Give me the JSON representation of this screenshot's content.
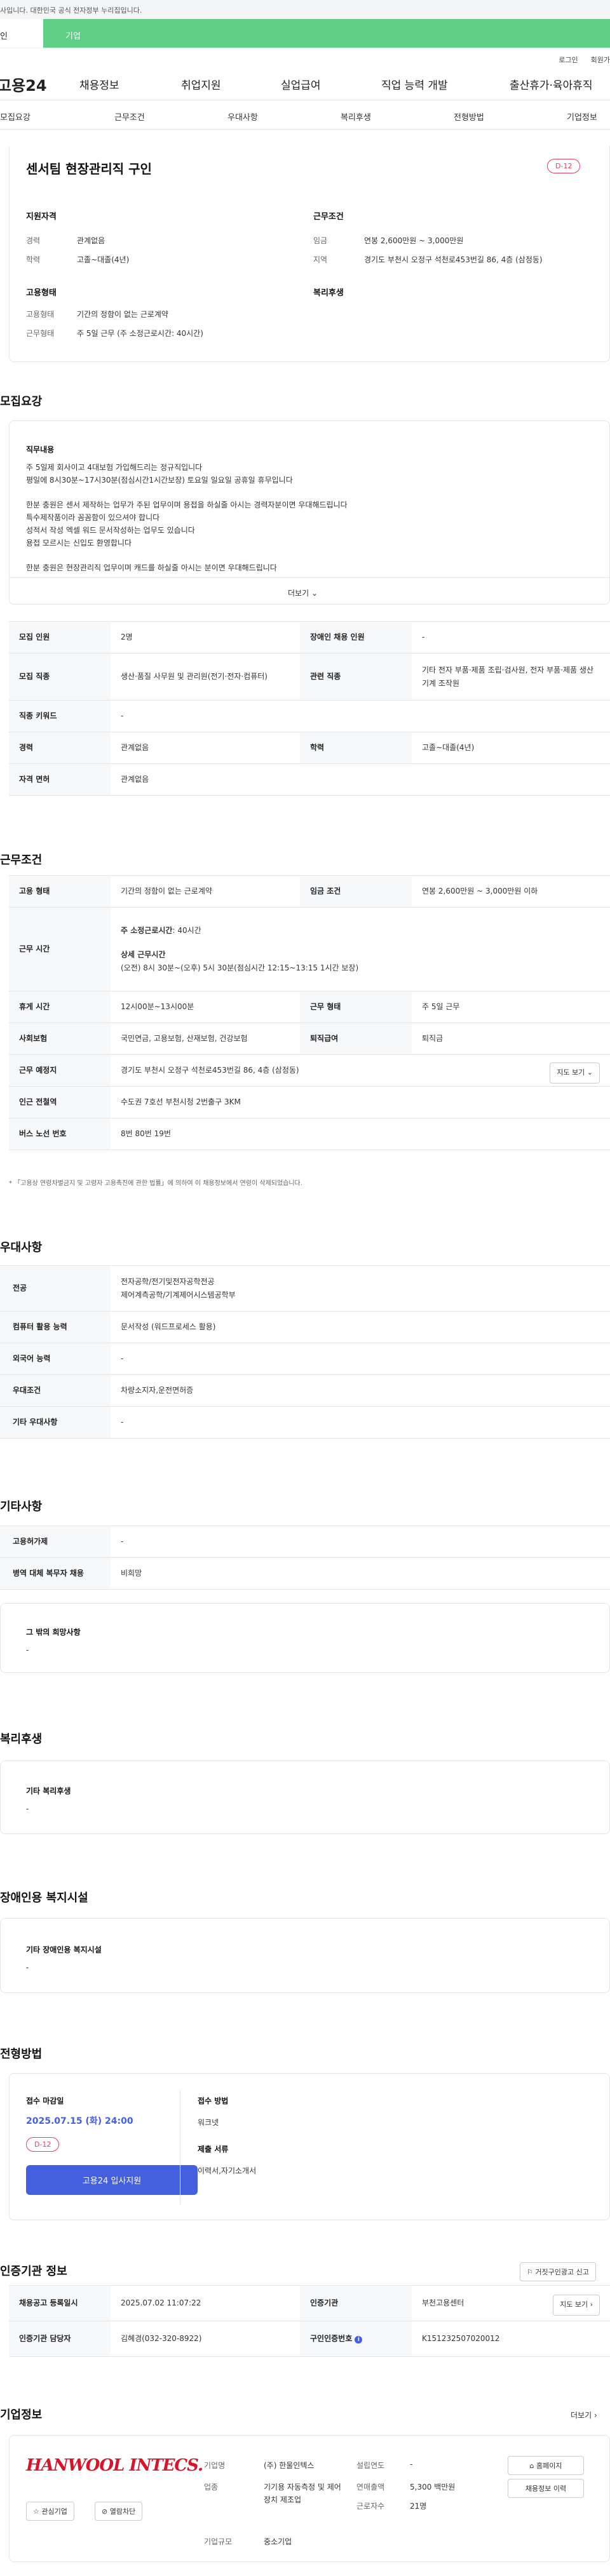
{
  "top_notice": "사입니다. 대한민국 공식 전자정부 누리집입니다.",
  "tabs": [
    "인",
    "기업"
  ],
  "util": [
    "로그인",
    "회원가"
  ],
  "gnb": {
    "logo": "고용24",
    "menu": [
      "채용정보",
      "취업지원",
      "실업급여",
      "직업 능력 개발",
      "출산휴가·육아휴직"
    ]
  },
  "subnav": [
    "모집요강",
    "근무조건",
    "우대사항",
    "복리후생",
    "전형방법",
    "기업정보"
  ],
  "job_title": "센서팀 현장관리직 구인",
  "dday": "D-12",
  "summary": {
    "qual_title": "지원자격",
    "career_lbl": "경력",
    "career_val": "관계없음",
    "edu_lbl": "학력",
    "edu_val": "고졸~대졸(4년)",
    "cond_title": "근무조건",
    "wage_lbl": "임금",
    "wage_val": "연봉 2,600만원 ~ 3,000만원",
    "region_lbl": "지역",
    "region_val": "경기도 부천시 오정구 석천로453번길 86, 4층 (삼정동)",
    "emp_title": "고용형태",
    "emptype_lbl": "고용형태",
    "emptype_val": "기간의 정함이 없는 근로계약",
    "worktype_lbl": "근무형태",
    "worktype_val": "주 5일 근무 (주 소정근로시간: 40시간)",
    "welfare_title": "복리후생"
  },
  "recruit": {
    "heading": "모집요강",
    "duty_title": "직무내용",
    "duty_text": "주 5일제 회사이고 4대보험 가입해드리는 정규직입니다\n평일에 8시30분~17시30분(점심시간1시간보장) 토요일 일요일 공휴일 휴무입니다\n\n한분 충원은 센서 제작하는 업무가 주된 업무이며 용접을 하실줄 아시는 경력자분이면 우대해드립니다\n특수제작품이라 꼼꼼함이 있으셔야 합니다\n성적서 작성 엑셀 워드 문서작성하는 업무도 있습니다\n용접 모르시는 신입도 환영합니다\n\n한분 충원은 현장관리직 업무이며 캐드를 하실줄 아시는 분이면 우대해드립니다",
    "more": "더보기",
    "rows": {
      "count_lbl": "모집 인원",
      "count_val": "2명",
      "disabled_lbl": "장애인 채용 인원",
      "disabled_val": "-",
      "job_lbl": "모집 직종",
      "job_val": "생산·품질 사무원 및 관리원(전기·전자·컴퓨터)",
      "rel_lbl": "관련 직종",
      "rel_val": "기타 전자 부품·제품 조립·검사원, 전자 부품·제품 생산기계 조작원",
      "kw_lbl": "직종 키워드",
      "kw_val": "-",
      "career_lbl": "경력",
      "career_val": "관계없음",
      "edu_lbl": "학력",
      "edu_val": "고졸~대졸(4년)",
      "license_lbl": "자격 면허",
      "license_val": "관계없음"
    }
  },
  "work": {
    "heading": "근무조건",
    "emp_lbl": "고용 형태",
    "emp_val": "기간의 정함이 없는 근로계약",
    "wage_lbl": "임금 조건",
    "wage_val": "연봉 2,600만원 ~ 3,000만원 이하",
    "time_lbl": "근무 시간",
    "time_weekly_lbl": "주 소정근로시간",
    "time_weekly_val": ": 40시간",
    "time_detail_lbl": "상세 근무시간",
    "time_detail_val": "(오전) 8시 30분~(오후) 5시 30분(점심시간 12:15~13:15 1시간 보장)",
    "break_lbl": "휴게 시간",
    "break_val": "12시00분~13시00분",
    "form_lbl": "근무 형태",
    "form_val": "주 5일 근무",
    "ins_lbl": "사회보험",
    "ins_val": "국민연금, 고용보험, 산재보험, 건강보험",
    "retire_lbl": "퇴직급여",
    "retire_val": "퇴직금",
    "place_lbl": "근무 예정지",
    "place_val": "경기도 부천시 오정구 석천로453번길 86, 4층 (삼정동)",
    "map_btn": "지도 보기",
    "subway_lbl": "인근 전철역",
    "subway_val": "수도권 7호선 부천시청 2번출구 3KM",
    "bus_lbl": "버스 노선 번호",
    "bus_val": "8번 80번 19번",
    "note": "「고용상 연령차별금지 및 고령자 고용촉진에 관한 법률」에 의하여 이 채용정보에서 연령이 삭제되었습니다."
  },
  "pref": {
    "heading": "우대사항",
    "major_lbl": "전공",
    "major_val": "전자공학/전기및전자공학전공\n제어계측공학/기계제어시스템공학부",
    "pc_lbl": "컴퓨터 활용 능력",
    "pc_val": "문서작성 (워드프로세스 활용)",
    "lang_lbl": "외국어 능력",
    "lang_val": "-",
    "cond_lbl": "우대조건",
    "cond_val": "차량소지자,운전면허증",
    "etc_lbl": "기타 우대사항",
    "etc_val": "-"
  },
  "etc": {
    "heading": "기타사항",
    "support_lbl": "고용허가제",
    "support_val": "-",
    "military_lbl": "병역 대체 복무자 채용",
    "military_val": "비희망",
    "other_title": "그 밖의 희망사항",
    "other_val": "-"
  },
  "welfare": {
    "heading": "복리후생",
    "title": "기타 복리후생",
    "val": "-"
  },
  "disabled_fac": {
    "heading": "장애인용 복지시설",
    "title": "기타 장애인용 복지시설",
    "val": "-"
  },
  "process": {
    "heading": "전형방법",
    "deadline_lbl": "접수 마감일",
    "deadline_val": "2025.07.15 (화) 24:00",
    "dday": "D-12",
    "apply_btn": "고용24 입사지원",
    "method_lbl": "접수 방법",
    "method_val": "워크넷",
    "docs_lbl": "제출 서류",
    "docs_val": "이력서,자기소개서"
  },
  "agency": {
    "heading": "인증기관 정보",
    "report_btn": "거짓구인광고 신고",
    "reg_lbl": "채용공고 등록일시",
    "reg_val": "2025.07.02 11:07:22",
    "org_lbl": "인증기관",
    "org_val": "부천고용센터",
    "map_btn": "지도 보기",
    "person_lbl": "인증기관 담당자",
    "person_val": "김혜경(032-320-8922)",
    "num_lbl": "구인인증번호",
    "num_val": "K151232507020012"
  },
  "company": {
    "heading": "기업정보",
    "more": "더보기",
    "logo": "HANWOOL INTECS.",
    "fav_btn": "관심기업",
    "block_btn": "열람차단",
    "name_lbl": "기업명",
    "name_val": "(주) 한울인텍스",
    "found_lbl": "설립연도",
    "found_val": "-",
    "biz_lbl": "업종",
    "biz_val": "기기용 자동측정 및 제어장치 제조업",
    "sales_lbl": "연매출액",
    "sales_val": "5,300 백만원",
    "emp_lbl": "근로자수",
    "emp_val": "21명",
    "size_lbl": "기업규모",
    "size_val": "중소기업",
    "home_btn": "홈페이지",
    "jobs_btn": "채용정보 이력"
  },
  "colors": {
    "accent": "#4460e0",
    "green": "#5fcf85",
    "dday": "#e5405e"
  }
}
